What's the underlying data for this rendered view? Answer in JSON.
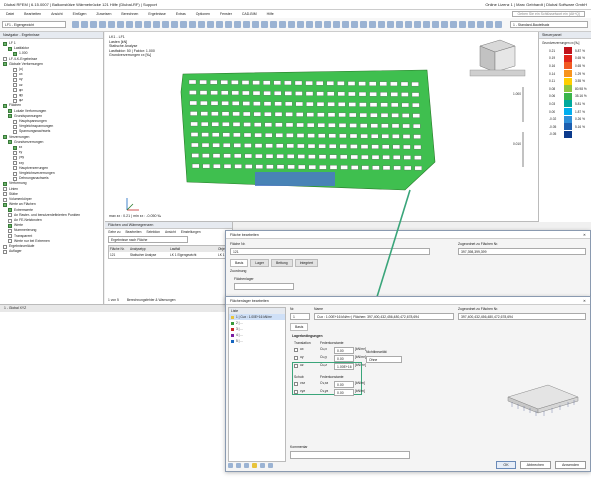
{
  "window": {
    "title": "Dlubal RFEM | 6.15.0007 | Balkonstütze Wärmebrücke 121 Hilfe (Dlubal-RF) | Support",
    "user": "Online Lizenz 1 | Marc Gebhardt | Dlubal Software GmbH"
  },
  "menu": {
    "items": [
      "Datei",
      "Bearbeiten",
      "Ansicht",
      "Einfügen",
      "Zuweisen",
      "Berechnen",
      "Ergebnisse",
      "Extras",
      "Optionen",
      "Fenster",
      "CAD-BIM",
      "Hilfe"
    ],
    "search_placeholder": "Geben Sie ein Schlüsselwort ein (Alt+Q)"
  },
  "toolbar": {
    "dropdown_left": "LF1 - Eigengewicht",
    "dropdown_right": "1 - Standard-Bauteilsatz"
  },
  "navigator": {
    "title": "Navigator - Ergebnisse",
    "items": [
      {
        "label": "LF 1",
        "indent": 0,
        "checked": true
      },
      {
        "label": "Lastfaktor",
        "indent": 1,
        "checked": true
      },
      {
        "label": "1.000",
        "indent": 2,
        "checked": true
      },
      {
        "label": "LF-/LK-Ergebnisse",
        "indent": 0,
        "checked": false
      },
      {
        "label": "Globale Verformungen",
        "indent": 0,
        "checked": true
      },
      {
        "label": "|u|",
        "indent": 2,
        "checked": false
      },
      {
        "label": "ux",
        "indent": 2,
        "checked": false
      },
      {
        "label": "uy",
        "indent": 2,
        "checked": false
      },
      {
        "label": "uz",
        "indent": 2,
        "checked": false
      },
      {
        "label": "φx",
        "indent": 2,
        "checked": false
      },
      {
        "label": "φy",
        "indent": 2,
        "checked": false
      },
      {
        "label": "φz",
        "indent": 2,
        "checked": false
      },
      {
        "label": "Flächen",
        "indent": 0,
        "checked": true
      },
      {
        "label": "Lokale Verformungen",
        "indent": 1,
        "checked": true
      },
      {
        "label": "Grundspannungen",
        "indent": 1,
        "checked": true
      },
      {
        "label": "Hauptspannungen",
        "indent": 2,
        "checked": false
      },
      {
        "label": "Vergleichsspannungen",
        "indent": 2,
        "checked": false
      },
      {
        "label": "Spannungsnachweis",
        "indent": 2,
        "checked": false
      },
      {
        "label": "Verzerrungen",
        "indent": 0,
        "checked": true
      },
      {
        "label": "Grundverzerrungen",
        "indent": 1,
        "checked": true
      },
      {
        "label": "εx",
        "indent": 2,
        "checked": true
      },
      {
        "label": "εy",
        "indent": 2,
        "checked": false
      },
      {
        "label": "γxy",
        "indent": 2,
        "checked": false
      },
      {
        "label": "εxy",
        "indent": 2,
        "checked": false
      },
      {
        "label": "Hauptverzerrungen",
        "indent": 2,
        "checked": false
      },
      {
        "label": "Vergleichsverzerrungen",
        "indent": 2,
        "checked": false
      },
      {
        "label": "Dehnungsnachweis",
        "indent": 2,
        "checked": false
      },
      {
        "label": "Verformung",
        "indent": 0,
        "checked": true
      },
      {
        "label": "Linien",
        "indent": 0,
        "checked": false
      },
      {
        "label": "Stäbe",
        "indent": 0,
        "checked": false
      },
      {
        "label": "Volumenkörper",
        "indent": 0,
        "checked": false
      },
      {
        "label": "Werte an Flächen",
        "indent": 0,
        "checked": true
      },
      {
        "label": "Extremwerte",
        "indent": 1,
        "checked": true
      },
      {
        "label": "An Raster- und benutzerdefinierten Punkten",
        "indent": 1,
        "checked": false
      },
      {
        "label": "An FE-Netzknoten",
        "indent": 1,
        "checked": false
      },
      {
        "label": "Werte",
        "indent": 1,
        "checked": true
      },
      {
        "label": "Nummerierung",
        "indent": 1,
        "checked": false
      },
      {
        "label": "Transparent",
        "indent": 1,
        "checked": false
      },
      {
        "label": "Werte nur bei Extremen",
        "indent": 1,
        "checked": false
      },
      {
        "label": "Ergebnisverläufe",
        "indent": 0,
        "checked": false
      },
      {
        "label": "Auflager",
        "indent": 0,
        "checked": false
      }
    ]
  },
  "viewport": {
    "header": "LK1 - LF1",
    "lines": [
      "Lasten [kN]",
      "Statische Analyse",
      "Lastfaktor: 50 | Faktor: 1.000",
      "Grundverzerrungen εx [‰]"
    ],
    "footer": "max εx : 0.21 | min εx : -0.050 ‰",
    "scale_value_1": "1.000",
    "scale_value_2": "0.010"
  },
  "legend": {
    "title": "Steuerpanel",
    "subtitle": "Grundverzerrungen εx [‰]",
    "stops": [
      {
        "value": "0.21",
        "pct": "5.87 %",
        "color": "#c1121a"
      },
      {
        "value": "0.19",
        "pct": "0.65 %",
        "color": "#e0241a"
      },
      {
        "value": "0.16",
        "pct": "0.65 %",
        "color": "#f15a22"
      },
      {
        "value": "0.14",
        "pct": "1.29 %",
        "color": "#f7941d"
      },
      {
        "value": "0.11",
        "pct": "3.55 %",
        "color": "#ffce00"
      },
      {
        "value": "0.08",
        "pct": "80.98 %",
        "color": "#8dc63f"
      },
      {
        "value": "0.06",
        "pct": "35.16 %",
        "color": "#39b54a"
      },
      {
        "value": "0.03",
        "pct": "5.81 %",
        "color": "#00a99d"
      },
      {
        "value": "0.00",
        "pct": "1.87 %",
        "color": "#00aeef"
      },
      {
        "value": "-0.02",
        "pct": "0.26 %",
        "color": "#2e8fd8"
      },
      {
        "value": "-0.05",
        "pct": "5.16 %",
        "color": "#1c5fb0"
      },
      {
        "value": "-0.05",
        "pct": "",
        "color": "#0b3a8c"
      }
    ]
  },
  "tables": {
    "title": "Flächen und Wärmegrenzen",
    "menu": [
      "Gehe zu",
      "Bearbeiten",
      "Selektion",
      "Ansicht",
      "Einstellungen"
    ],
    "filter_label": "Ergebnisse nach Fläche",
    "columns": [
      "Fläche Nr.",
      "Analysetyp",
      "Lastfall",
      "Objekt"
    ],
    "row": [
      "121",
      "Statischer Analyse",
      "LK 1 Eigengewicht",
      "LK 1"
    ],
    "pager": "1 von 5",
    "tab_label": "Berechnungsfehler & Warnungen"
  },
  "status": {
    "left": "1 - Global XYZ",
    "right": "KS: Global XYZ | Ebene: XY"
  },
  "dialog1": {
    "title": "Fläche bearbeiten",
    "field_label": "Fläche Nr.",
    "field_value": "121",
    "side_label": "Zugeordnet zu Flächen Nr.",
    "side_value": "397,398,399,399",
    "tabs": [
      "Basis",
      "Lager",
      "Bettung",
      "Integriert"
    ],
    "section": "Zuordnung",
    "flaechenlager": "Flächenlager"
  },
  "dialog2": {
    "title": "Flächenlager bearbeiten",
    "list_header": "Liste",
    "list_items": [
      {
        "label": "1 | Cux : 1.00E+16 kN/m³"
      },
      {
        "label": "2 | ..."
      },
      {
        "label": "3 | ..."
      },
      {
        "label": "4 | ..."
      },
      {
        "label": "5 | ..."
      }
    ],
    "no_label": "Nr.",
    "no_value": "1",
    "name_label": "Name",
    "name_value": "Cux : 1.00E+16 kN/m³ | Flächen: 397,400,432,456,480,472,678,694",
    "assigned_label": "Zugeordnet zu Flächen Nr.",
    "assigned_value": "397,400,432,456,480,472,678,694",
    "tab": "Basis",
    "group_title": "Lagerbedingungen",
    "translation_label": "Translation",
    "spring_label": "Federkonstante",
    "rows": [
      {
        "axis": "ux",
        "sym": "Cu,x",
        "value": "0.00",
        "unit": "[kN/m³]"
      },
      {
        "axis": "uy",
        "sym": "Cu,y",
        "value": "0.00",
        "unit": "[kN/m³]"
      },
      {
        "axis": "uz",
        "sym": "Cu,z",
        "value": "1.00E+16",
        "unit": "[kN/m³]"
      }
    ],
    "shear_label": "Schub",
    "shear_spring_label": "Federkonstante",
    "shear_rows": [
      {
        "axis": "vxz",
        "sym": "Cv,xz",
        "value": "0.00",
        "unit": "[kN/m]"
      },
      {
        "axis": "vyz",
        "sym": "Cv,yz",
        "value": "0.00",
        "unit": "[kN/m]"
      }
    ],
    "nonlinear_label": "Nichtlinearität",
    "nonlinear_value": "Ohne",
    "comment_label": "Kommentar",
    "ok": "OK",
    "cancel": "Abbrechen",
    "apply": "Anwenden"
  }
}
